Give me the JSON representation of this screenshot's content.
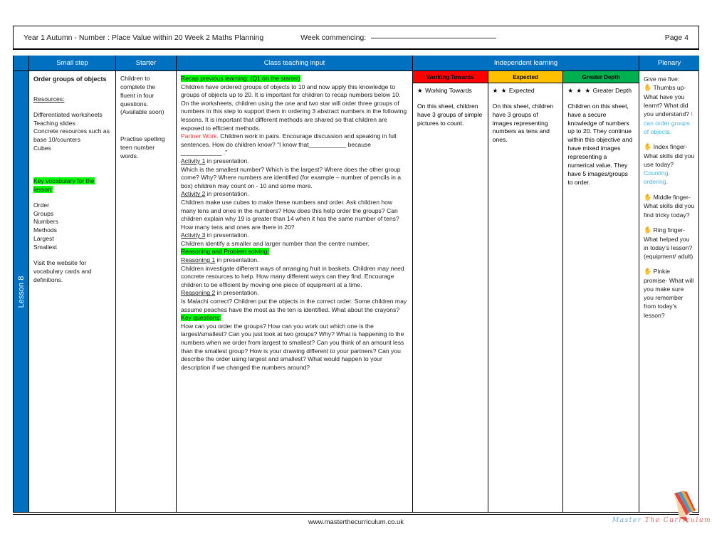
{
  "header": {
    "title": "Year 1 Autumn -  Number : Place Value within 20 Week 2 Maths Planning",
    "week_commencing_label": "Week commencing:",
    "page_label": "Page 4"
  },
  "table": {
    "columns": [
      {
        "label": "",
        "name": "lesson"
      },
      {
        "label": "Small step",
        "name": "small-step"
      },
      {
        "label": "Starter",
        "name": "starter"
      },
      {
        "label": "Class teaching input",
        "name": "class-teaching-input"
      },
      {
        "label": "Independent learning",
        "name": "independent-learning"
      },
      {
        "label": "Plenary",
        "name": "plenary"
      }
    ],
    "lesson_label": "Lesson 8",
    "small_step": {
      "title": "Order groups of objects",
      "resources_heading": "Resources:",
      "resources": "Differentiated worksheets\nTeaching slides\nConcrete resources such as base 10/counters\nCubes",
      "vocab_heading": "Key vocabulary for the lesson:",
      "vocab": "Order\nGroups\nNumbers\nMethods\nLargest\nSmallest",
      "vocab_note": "Visit the website for vocabulary cards and definitions."
    },
    "starter": {
      "para1": "Children to complete the fluent in four questions. (Available soon)",
      "para2": "Practise spelling teen number words."
    },
    "teaching": {
      "recap_heading": "Recap previous learning: (Q1 on the starter)",
      "recap_body": "Children have ordered groups of objects to 10 and now apply this knowledge to groups of objects up to 20. It is important for children to recap numbers below 10. On the worksheets, children using the one and two star will order three groups of numbers in this step to support them in ordering 3 abstract numbers in the following lessons. It is important that different methods are shared so that children are exposed to efficient methods.",
      "partner_label": "Partner Work.",
      "partner_body": " Children work  in pairs. Encourage discussion and speaking in full sentences. How do children know?  “I know that___________ because ____________ .”",
      "activity1_label": "Activity 1",
      "activity1_suffix": " in presentation.",
      "activity1_body": "Which is the smallest number? Which is the largest? Where does the other group come? Why? Where numbers are identified (for example – number of pencils in a box) children may count on - 10 and some more.",
      "activity2_label": "Activity 2",
      "activity2_suffix": " in presentation.",
      "activity2_body": "Children make use cubes to make these numbers and order. Ask children how many tens and ones in the numbers? How does this help order the groups? Can children explain why 19 is greater than 14 when it has the same number of tens? How many tens and ones are there in 20?",
      "activity3_label": "Activity 3",
      "activity3_suffix": " in presentation.",
      "activity3_body": "Children identify a smaller and larger number than the centre number.",
      "reasoning_heading": "Reasoning and Problem solving:",
      "reasoning1_label": "Reasoning 1",
      "reasoning1_suffix": " in presentation.",
      "reasoning1_body": "Children investigate different ways of arranging fruit in baskets. Children may need concrete resources to help. How many different ways can they find. Encourage children to be efficient by moving one piece of equipment at a time.",
      "reasoning2_label": "Reasoning 2",
      "reasoning2_suffix": " in presentation.",
      "reasoning2_body": "Is Malachi correct? Children put the objects in the correct order. Some children may assume peaches have the most as the ten is identified. What about the crayons?",
      "key_questions_heading": "Key questions:",
      "key_questions_body": "How can you order the groups? How can you work out which one is the largest/smallest? Can you just look at two groups? Why? What is happening to the numbers when we order from largest to smallest? Can you think of an amount less than the smallest group? How is your drawing different to your partners? Can you describe the order using  largest and smallest? What would happen to your description if we changed the numbers around?"
    },
    "independent": [
      {
        "header": "Working Towards",
        "header_color": "#ff0000",
        "stars": "★",
        "label": "Working Towards",
        "body": "On this sheet, children have 3 groups of simple pictures to count."
      },
      {
        "header": "Expected",
        "header_color": "#ffc000",
        "stars": "★ ★",
        "label": "Expected",
        "body": "On this sheet, children have 3 groups  of images representing numbers as tens and ones."
      },
      {
        "header": "Greater Depth",
        "header_color": "#00b050",
        "stars": "★ ★ ★",
        "label": "Greater Depth",
        "body": "Children on this sheet, have a secure knowledge of numbers up to 20. They continue within this objective and have mixed images representing a numerical value. They have 5 images/groups to order."
      }
    ],
    "plenary": {
      "intro": "Give me five:",
      "items": [
        {
          "icon": "hand-icon",
          "question": "Thumbs up- What have you learnt? What did you understand?",
          "answer": "I can order groups of objects."
        },
        {
          "icon": "hand-icon",
          "question": "Index finger- What skills did you use today?",
          "answer": "Counting, ordering."
        },
        {
          "icon": "hand-icon",
          "question": "Middle finger- What skills did you find tricky today?",
          "answer": ""
        },
        {
          "icon": "hand-icon",
          "question": "Ring finger- What helped you in today’s lesson? (equipment/ adult)",
          "answer": ""
        },
        {
          "icon": "hand-icon",
          "question": "Pinkie promise- What will you make sure you remember from today’s lesson?",
          "answer": ""
        }
      ]
    }
  },
  "footer": {
    "url": "www.masterthecurriculum.co.uk",
    "logo_word1": "Master",
    "logo_word2": "The",
    "logo_word3": "Curriculum"
  },
  "colors": {
    "header_blue": "#0070c0",
    "highlight_green": "#00ff00",
    "red_text": "#ff3333",
    "answer_blue": "#41b6e6",
    "working_towards": "#ff0000",
    "expected": "#ffc000",
    "greater_depth": "#00b050"
  }
}
